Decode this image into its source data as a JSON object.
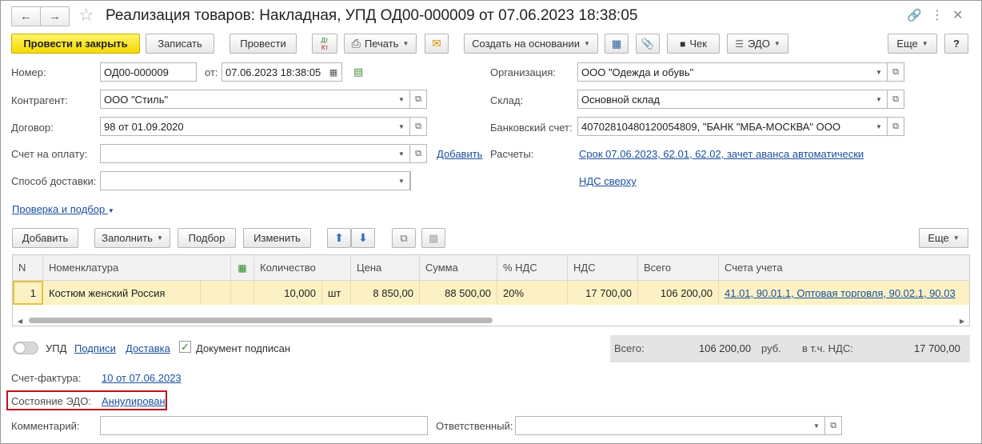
{
  "window": {
    "title": "Реализация товаров: Накладная, УПД ОД00-000009 от 07.06.2023 18:38:05",
    "back_icon": "arrow-left-icon",
    "forward_icon": "arrow-right-icon",
    "favorite_icon": "star-icon",
    "link_icon": "link-icon",
    "more_icon": "kebab-icon",
    "close_icon": "close-icon"
  },
  "toolbar": {
    "post_close": "Провести и закрыть",
    "save": "Записать",
    "post": "Провести",
    "dtkt_top": "Дт",
    "dtkt_bottom": "Кт",
    "print": "Печать",
    "create_based": "Создать на основании",
    "check": "Чек",
    "edo": "ЭДО",
    "more": "Еще",
    "help": "?"
  },
  "form": {
    "number_label": "Номер:",
    "number_value": "ОД00-000009",
    "from_label": "от:",
    "date_value": "07.06.2023 18:38:05",
    "contractor_label": "Контрагент:",
    "contractor_value": "ООО \"Стиль\"",
    "contract_label": "Договор:",
    "contract_value": "98 от 01.09.2020",
    "invoice_pay_label": "Счет на оплату:",
    "invoice_pay_value": "",
    "add_link": "Добавить",
    "delivery_label": "Способ доставки:",
    "delivery_value": "",
    "org_label": "Организация:",
    "org_value": "ООО \"Одежда и обувь\"",
    "warehouse_label": "Склад:",
    "warehouse_value": "Основной склад",
    "bank_label": "Банковский счет:",
    "bank_value": "40702810480120054809, \"БАНК \"МБА-МОСКВА\" ООО",
    "settlements_label": "Расчеты:",
    "settlements_link": "Срок 07.06.2023, 62.01, 62.02, зачет аванса автоматически",
    "vat_link": "НДС сверху",
    "check_link": "Проверка и подбор"
  },
  "table_toolbar": {
    "add": "Добавить",
    "fill": "Заполнить",
    "select": "Подбор",
    "change": "Изменить",
    "more": "Еще"
  },
  "table": {
    "headers": [
      "N",
      "Номенклатура",
      "Количество",
      "Цена",
      "Сумма",
      "% НДС",
      "НДС",
      "Всего",
      "Счета учета"
    ],
    "rows": [
      {
        "n": "1",
        "item": "Костюм женский Россия",
        "qty": "10,000",
        "unit": "шт",
        "price": "8 850,00",
        "sum": "88 500,00",
        "vat_rate": "20%",
        "vat": "17 700,00",
        "total": "106 200,00",
        "accounts": "41.01, 90.01.1, Оптовая торговля, 90.02.1, 90.03"
      }
    ]
  },
  "footer": {
    "upd_label": "УПД",
    "signatures_link": "Подписи",
    "delivery_link": "Доставка",
    "signed_label": "Документ подписан",
    "total_label": "Всего:",
    "total_value": "106 200,00",
    "currency": "руб.",
    "vat_incl_label": "в т.ч. НДС:",
    "vat_incl_value": "17 700,00",
    "invoice_label": "Счет-фактура:",
    "invoice_link": "10 от 07.06.2023",
    "edo_state_label": "Состояние ЭДО:",
    "edo_state_link": "Аннулирован",
    "comment_label": "Комментарий:",
    "comment_value": "",
    "responsible_label": "Ответственный:",
    "responsible_value": ""
  },
  "colors": {
    "primary_button": "#f5d900",
    "selected_row": "#fbf1c4",
    "link": "#1a4f9c",
    "highlight_frame": "#c0141a"
  }
}
